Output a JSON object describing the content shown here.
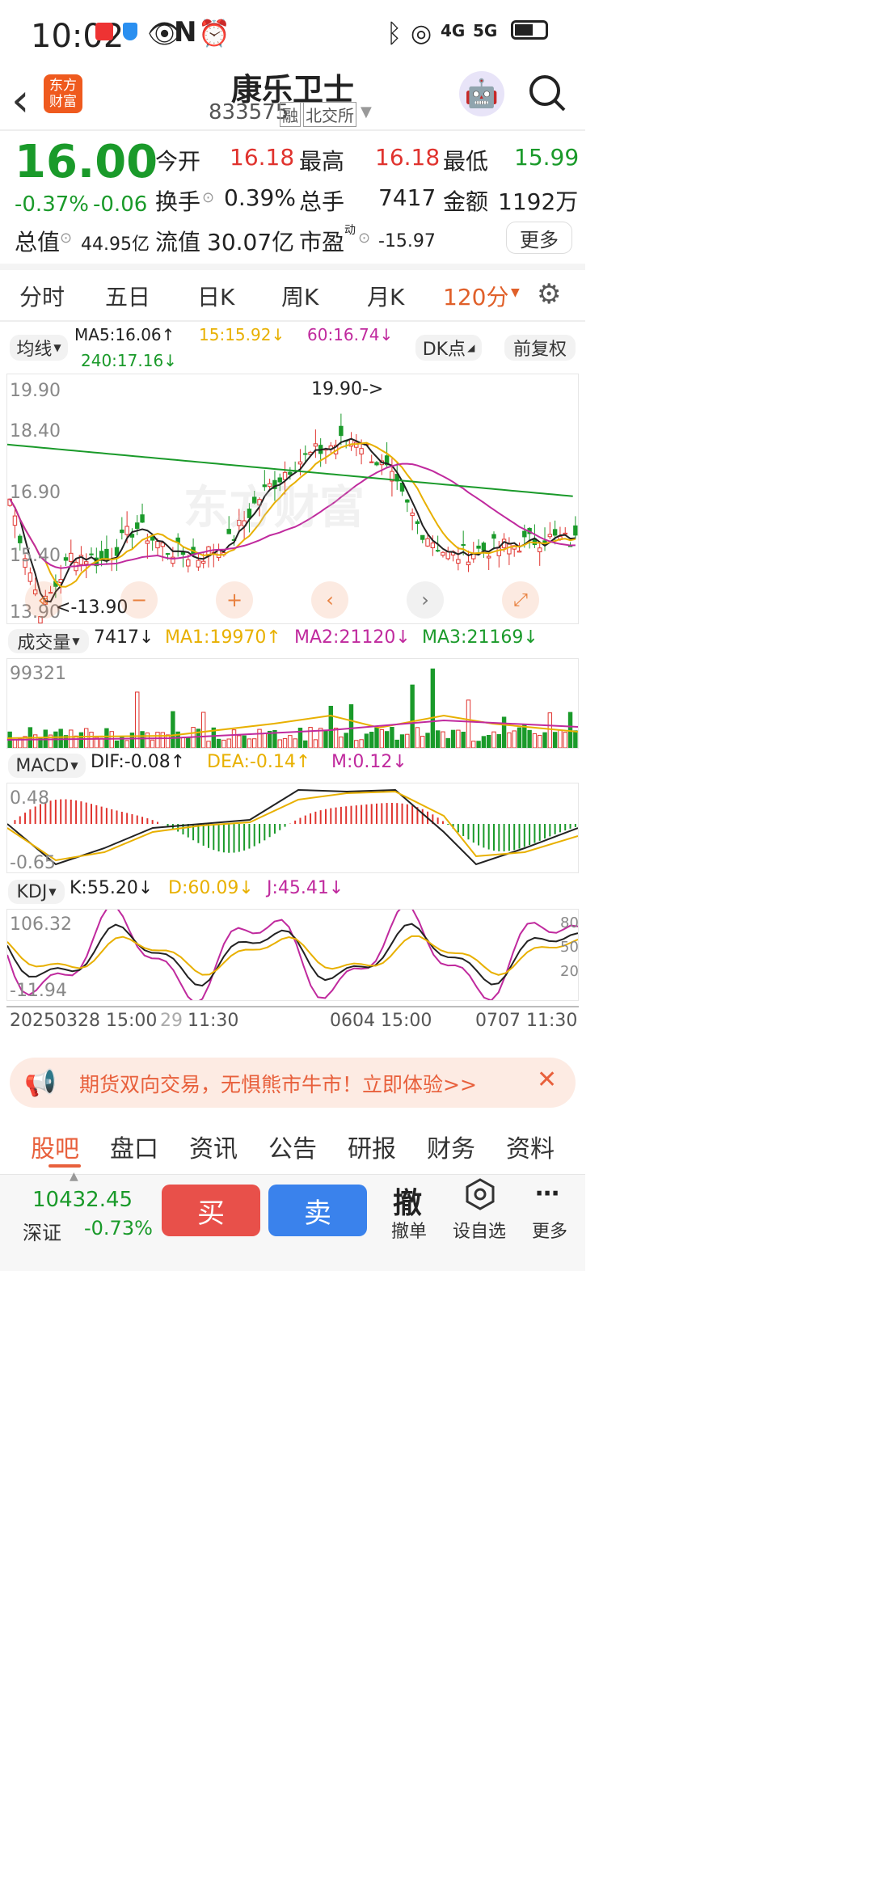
{
  "status": {
    "time": "10:02",
    "net1": "4G",
    "net2": "5G"
  },
  "header": {
    "name": "康乐卫士",
    "code": "833575",
    "tag1": "融",
    "tag2": "北交所",
    "logo": "东方\n财富"
  },
  "quote": {
    "price": "16.00",
    "pct": "-0.37%",
    "chg": "-0.06",
    "open_l": "今开",
    "open": "16.18",
    "high_l": "最高",
    "high": "16.18",
    "low_l": "最低",
    "low": "15.99",
    "turn_l": "换手",
    "turn": "0.39%",
    "vol_l": "总手",
    "vol": "7417",
    "amt_l": "金额",
    "amt": "1192万",
    "mcap_l": "总值",
    "mcap": "44.95亿",
    "fcap_l": "流值",
    "fcap": "30.07亿",
    "pe_l": "市盈",
    "pe_sup": "动",
    "pe": "-15.97",
    "more": "更多"
  },
  "tabs": {
    "t1": "分时",
    "t2": "五日",
    "t3": "日K",
    "t4": "周K",
    "t5": "月K",
    "t6": "120分"
  },
  "ma": {
    "sel": "均线",
    "ma5": "MA5:16.06↑",
    "ma15": "15:15.92↓",
    "ma60": "60:16.74↓",
    "ma240": "240:17.16↓",
    "dk": "DK点",
    "fq": "前复权"
  },
  "kline": {
    "y1": "19.90",
    "y2": "18.40",
    "y3": "16.90",
    "y4": "15.40",
    "y5": "13.90",
    "hi": "19.90->",
    "lo": "<-13.90"
  },
  "volume": {
    "sel": "成交量",
    "v": "7417↓",
    "ma1": "MA1:19970↑",
    "ma2": "MA2:21120↓",
    "ma3": "MA3:21169↓",
    "ymax": "99321"
  },
  "macd": {
    "sel": "MACD",
    "dif": "DIF:-0.08↑",
    "dea": "DEA:-0.14↑",
    "m": "M:0.12↓",
    "y1": "0.48",
    "y2": "-0.65"
  },
  "kdj": {
    "sel": "KDJ",
    "k": "K:55.20↓",
    "d": "D:60.09↓",
    "j": "J:45.41↓",
    "y1": "106.32",
    "y2": "-11.94",
    "r1": "80",
    "r2": "50",
    "r3": "20"
  },
  "xaxis": {
    "a": "20250328 15:00",
    "b": "29",
    "c": "11:30",
    "d": "0604 15:00",
    "e": "0707 11:30"
  },
  "banner": {
    "text": "期货双向交易，无惧熊市牛市！立即体验>>"
  },
  "subtabs": {
    "s1": "股吧",
    "s2": "盘口",
    "s3": "资讯",
    "s4": "公告",
    "s5": "研报",
    "s6": "财务",
    "s7": "资料"
  },
  "bottom": {
    "index": "10432.45",
    "name": "深证",
    "pct": "-0.73%",
    "buy": "买",
    "sell": "卖",
    "cancel_icon": "撤",
    "cancel": "撤单",
    "fav": "设自选",
    "more": "更多"
  },
  "colors": {
    "up": "#e0332e",
    "down": "#1a9a2a",
    "ma5": "#222222",
    "ma15": "#e8b000",
    "ma60": "#c02a9e",
    "ma240": "#1a9a2a",
    "accent": "#e8603c"
  }
}
